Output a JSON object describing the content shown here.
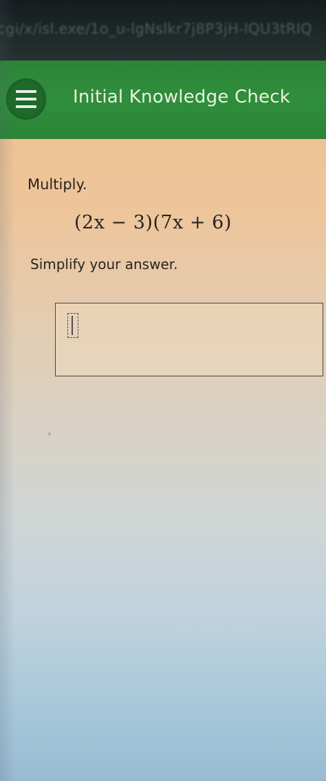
{
  "browser": {
    "url": "cgi/x/isl.exe/1o_u-lgNslkr7j8P3jH-lQU3tRIQ"
  },
  "header": {
    "menu_icon": "hamburger-menu-icon",
    "title": "Initial Knowledge Check",
    "background_color": "#2f8e3b"
  },
  "question": {
    "instruction": "Multiply.",
    "expression": "(2x − 3)(7x + 6)",
    "prompt": "Simplify your answer."
  },
  "answer": {
    "value": "",
    "placeholder_icon": "answer-input-slot-icon"
  }
}
